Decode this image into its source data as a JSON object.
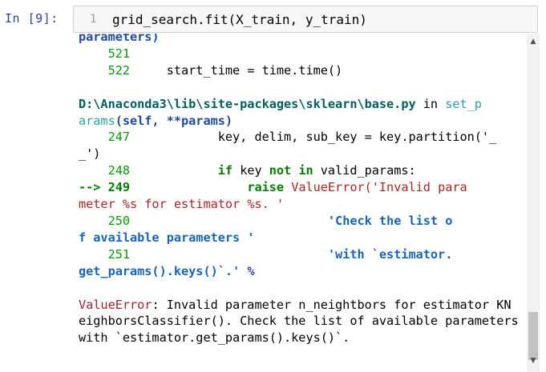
{
  "cell": {
    "prompt": "In  [9]:",
    "line_number": "1",
    "code": "grid_search.fit(X_train, y_train)"
  },
  "traceback": {
    "line_cut": "parameters)",
    "line_521_no": "521",
    "line_522_no": "522",
    "line_522_code": "start_time = time.time()",
    "file_path": "D:\\Anaconda3\\lib\\site-packages\\sklearn\\base.py",
    "in_word": " in ",
    "func_part1": "set_p",
    "func_part2": "arams",
    "args": "(self, **params)",
    "line_247_no": "247",
    "line_247_code_a": "key, delim, sub_key = key.partition('_",
    "line_247_code_b": "_')",
    "line_248_no": "248",
    "line_248_if": "if",
    "line_248_key": " key ",
    "line_248_not": "not",
    "line_248_in": " in",
    "line_248_rest": " valid_params:",
    "arrow": "--> 249",
    "line_249_raise": "raise",
    "line_249_err": " ValueError('Invalid para",
    "line_249_cont": "meter %s for estimator %s. '",
    "line_250_no": "250",
    "line_250_str_a": "'Check the list o",
    "line_250_str_b": "f available parameters '",
    "line_251_no": "251",
    "line_251_str": "'with `estimator.",
    "line_251_cont_a": "get_params().keys()`.'",
    "line_251_cont_b": " %",
    "error_name": "ValueError",
    "error_msg_1": ": Invalid parameter n_neightbors for estimator KN",
    "error_msg_2": "eighborsClassifier(). Check the list of available parameters",
    "error_msg_3": "with `estimator.get_params().keys()`."
  },
  "scrollbar": {
    "up_icon": "arrow-up-icon",
    "down_icon": "arrow-down-icon"
  }
}
